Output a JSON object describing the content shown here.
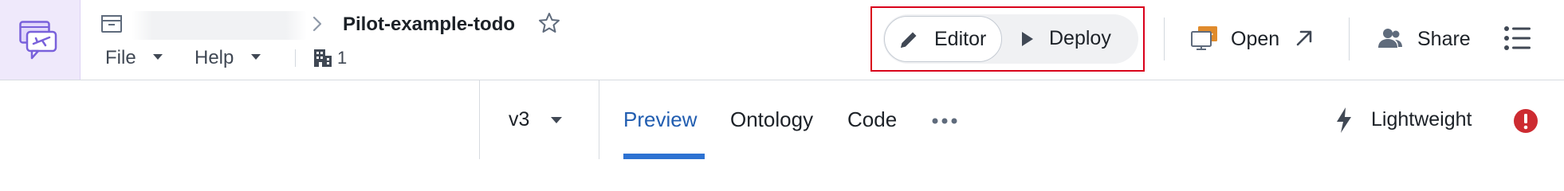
{
  "header": {
    "document_title": "Pilot-example-todo",
    "menus": [
      {
        "label": "File"
      },
      {
        "label": "Help"
      }
    ],
    "branch_count": "1",
    "icons": {
      "app": "airplane-chat-icon",
      "folder": "folder-icon",
      "breadcrumb_separator": "chevron-right-icon",
      "favorite": "star-icon",
      "branches": "building-icon"
    }
  },
  "mode_toggle": {
    "editor_label": "Editor",
    "deploy_label": "Deploy",
    "selected": "Editor"
  },
  "actions": {
    "open_label": "Open",
    "share_label": "Share"
  },
  "subheader": {
    "version": "v3",
    "tabs": [
      {
        "label": "Preview",
        "active": true
      },
      {
        "label": "Ontology",
        "active": false
      },
      {
        "label": "Code",
        "active": false
      }
    ],
    "lightweight_label": "Lightweight"
  },
  "colors": {
    "accent": "#2d72d2",
    "active_tab_text": "#215db0",
    "highlight_box": "#d9001b",
    "error": "#cd2b31",
    "app_tile": "#efe9fb",
    "app_icon": "#7961db"
  }
}
